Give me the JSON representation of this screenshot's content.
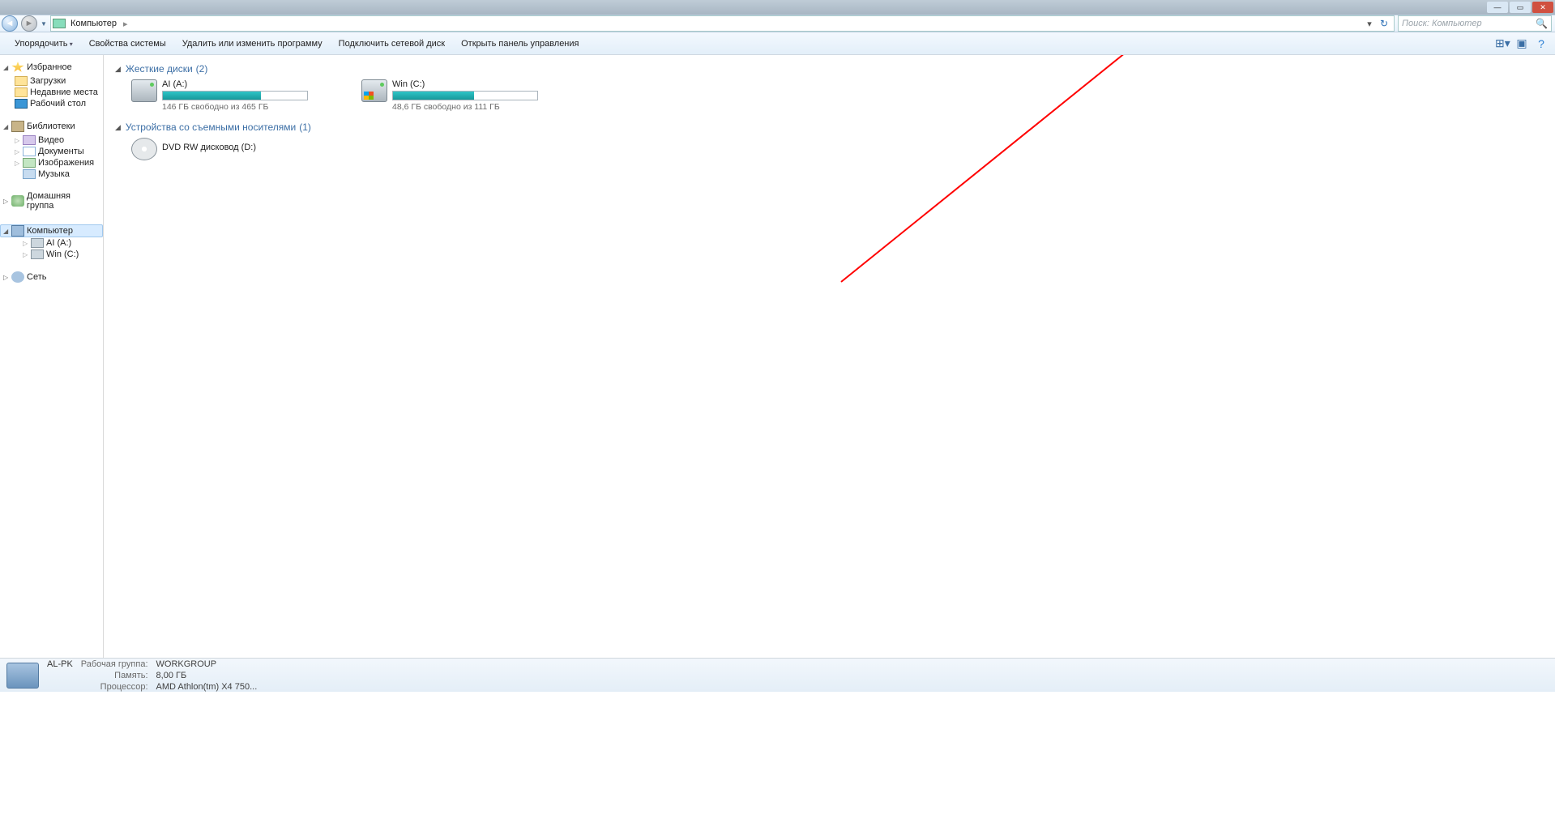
{
  "addressbar": {
    "location": "Компьютер",
    "separator": "▸",
    "dropdown": "▾",
    "refresh": "↻"
  },
  "search": {
    "placeholder": "Поиск: Компьютер"
  },
  "toolbar": {
    "organize": "Упорядочить",
    "sysprops": "Свойства системы",
    "uninstall": "Удалить или изменить программу",
    "netdrive": "Подключить сетевой диск",
    "ctrlpanel": "Открыть панель управления"
  },
  "sidebar": {
    "favorites": {
      "label": "Избранное"
    },
    "fav_items": {
      "downloads": "Загрузки",
      "recent": "Недавние места",
      "desktop": "Рабочий стол"
    },
    "libraries": {
      "label": "Библиотеки"
    },
    "lib_items": {
      "video": "Видео",
      "docs": "Документы",
      "images": "Изображения",
      "music": "Музыка"
    },
    "homegroup": {
      "label": "Домашняя группа"
    },
    "computer": {
      "label": "Компьютер"
    },
    "comp_items": {
      "a": "AI (A:)",
      "c": "Win (C:)"
    },
    "network": {
      "label": "Сеть"
    }
  },
  "content": {
    "cat_hdd": "Жесткие диски",
    "cat_hdd_count": "(2)",
    "cat_rem": "Устройства со съемными носителями",
    "cat_rem_count": "(1)",
    "drives": {
      "a": {
        "name": "AI (A:)",
        "sub": "146 ГБ свободно из 465 ГБ",
        "fill": 68
      },
      "c": {
        "name": "Win (C:)",
        "sub": "48,6 ГБ свободно из 111 ГБ",
        "fill": 56
      },
      "d": {
        "name": "DVD RW дисковод (D:)"
      }
    }
  },
  "status": {
    "name": "AL-PK",
    "wg_lbl": "Рабочая группа:",
    "wg_val": "WORKGROUP",
    "mem_lbl": "Память:",
    "mem_val": "8,00 ГБ",
    "cpu_lbl": "Процессор:",
    "cpu_val": "AMD Athlon(tm) X4 750..."
  }
}
